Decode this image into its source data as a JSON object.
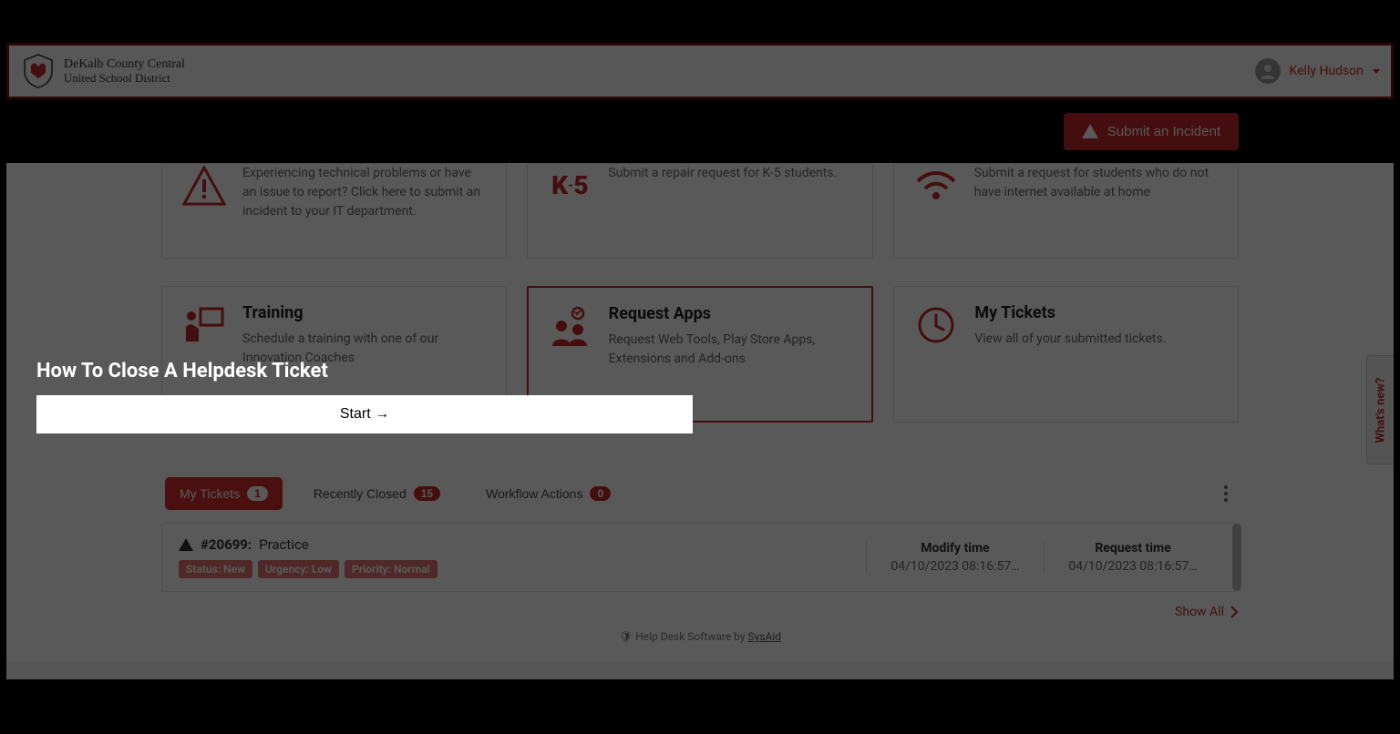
{
  "header": {
    "org_line1": "DeKalb County Central",
    "org_line2": "United School District",
    "user_name": "Kelly Hudson"
  },
  "submit_button": "Submit an Incident",
  "cards_row1": [
    {
      "title": "",
      "desc": "Experiencing technical problems or have an issue to report? Click here to submit an incident to your IT department.",
      "icon": "alert"
    },
    {
      "title": "",
      "desc": "Submit a repair request for K-5 students.",
      "icon": "k5"
    },
    {
      "title": "",
      "desc": "Submit a request for students who do not have internet available at home",
      "icon": "wifi"
    }
  ],
  "cards_row2": [
    {
      "title": "Training",
      "desc": "Schedule a training with one of our Innovation Coaches",
      "icon": "training"
    },
    {
      "title": "Request Apps",
      "desc": "Request Web Tools, Play Store Apps, Extensions and Add-ons",
      "icon": "apps",
      "selected": true
    },
    {
      "title": "My Tickets",
      "desc": "View all of your submitted tickets.",
      "icon": "tickets"
    }
  ],
  "tabs": {
    "my_tickets": {
      "label": "My Tickets",
      "count": "1"
    },
    "recently_closed": {
      "label": "Recently Closed",
      "count": "15"
    },
    "workflow": {
      "label": "Workflow Actions",
      "count": "0"
    }
  },
  "ticket": {
    "id": "#20699:",
    "subject": "Practice",
    "tags": {
      "status": "Status: New",
      "urgency": "Urgency: Low",
      "priority": "Priority: Normal"
    },
    "modify_label": "Modify time",
    "modify_value": "04/10/2023 08:16:57…",
    "request_label": "Request time",
    "request_value": "04/10/2023 08:16:57…"
  },
  "show_all": "Show All",
  "footer": {
    "text": "Help Desk Software by ",
    "link": "SysAid"
  },
  "whats_new": "What's new?",
  "tutorial": {
    "title": "How To Close A Helpdesk Ticket",
    "start": "Start →"
  }
}
